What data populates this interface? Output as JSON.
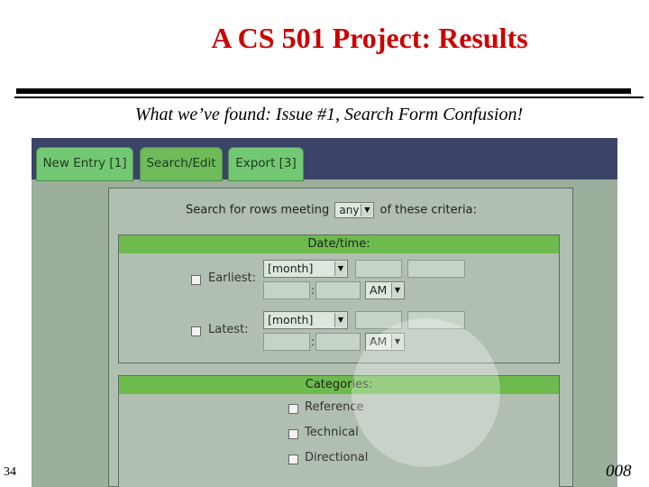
{
  "slide": {
    "title": "A CS 501 Project: Results",
    "subtitle": "What we’ve found: Issue #1, Search Form Confusion!",
    "number": "34",
    "footer_fragment": "008"
  },
  "tabs": [
    {
      "label": "New Entry [1]",
      "active": false
    },
    {
      "label": "Search/Edit",
      "active": true
    },
    {
      "label": "Export [3]",
      "active": false
    }
  ],
  "criteria": {
    "prefix": "Search for rows meeting",
    "match_value": "any",
    "suffix": "of these criteria:"
  },
  "datetime": {
    "header": "Date/time:",
    "earliest": {
      "label": "Earliest:",
      "month": "[month]",
      "ampm": "AM",
      "colon": ":"
    },
    "latest": {
      "label": "Latest:",
      "month": "[month]",
      "ampm": "AM",
      "colon": ":"
    }
  },
  "categories": {
    "header": "Categories:",
    "items": [
      "Reference",
      "Technical",
      "Directional"
    ]
  },
  "colors": {
    "title": "#cc0000",
    "tab_green": "#73c873",
    "header_green": "#6dbb4d",
    "top_band": "#3b4468"
  }
}
